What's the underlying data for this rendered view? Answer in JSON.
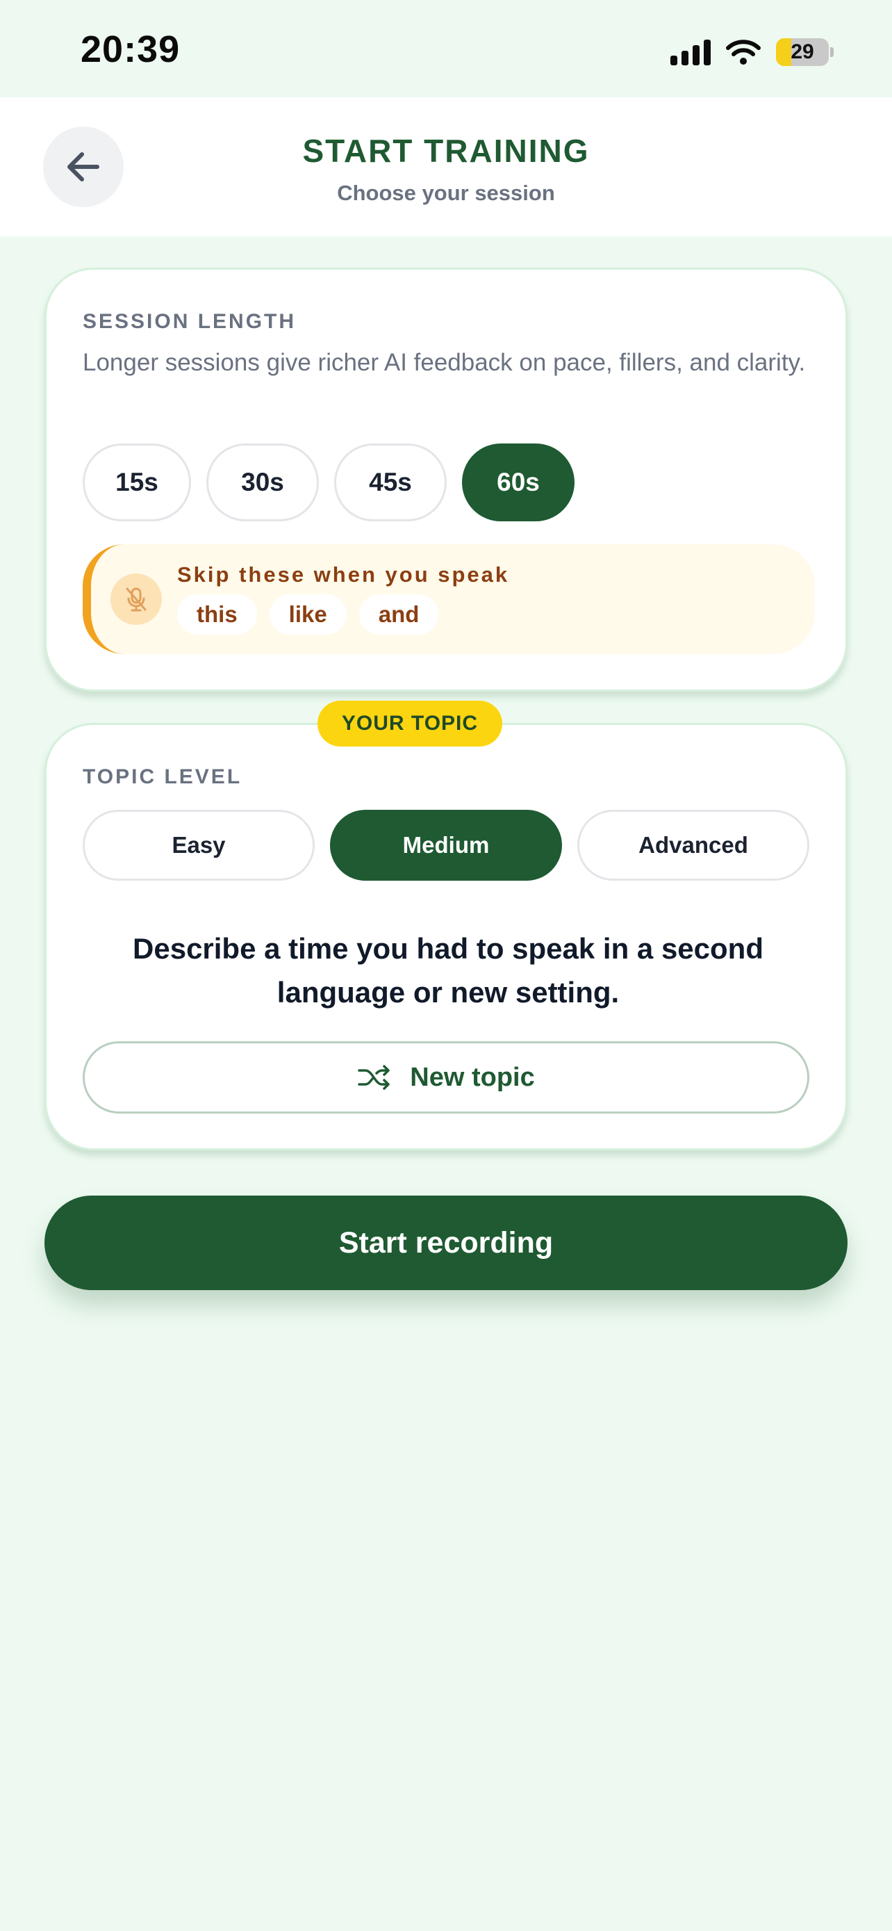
{
  "status_bar": {
    "time": "20:39",
    "battery": "29"
  },
  "header": {
    "title": "START TRAINING",
    "subtitle": "Choose your session"
  },
  "session": {
    "label": "SESSION LENGTH",
    "description": "Longer sessions give richer AI feedback on pace, fillers, and clarity.",
    "options": [
      "15s",
      "30s",
      "45s",
      "60s"
    ],
    "selected": "60s"
  },
  "skip": {
    "title": "Skip these when you speak",
    "words": [
      "this",
      "like",
      "and"
    ]
  },
  "topic": {
    "badge": "YOUR TOPIC",
    "level_label": "TOPIC LEVEL",
    "levels": [
      "Easy",
      "Medium",
      "Advanced"
    ],
    "selected_level": "Medium",
    "text": "Describe a time you had to speak in a second language or new setting.",
    "new_topic_label": "New topic"
  },
  "start_label": "Start recording",
  "colors": {
    "accent": "#1f5a32",
    "badge": "#fbd50f",
    "warn": "#f1a21e",
    "background": "#eefaf1"
  }
}
